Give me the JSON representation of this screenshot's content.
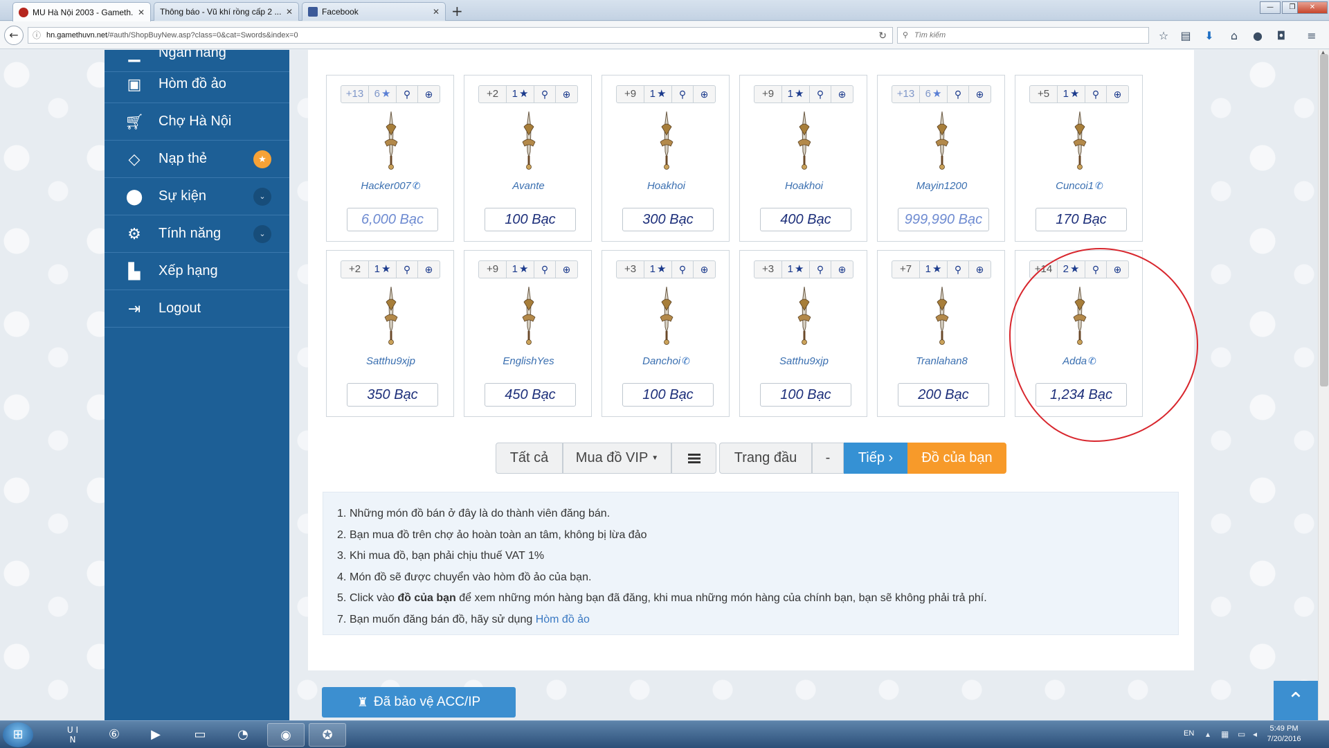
{
  "browser": {
    "tabs": [
      {
        "title": "MU Hà Nội 2003 - Gameth...",
        "favicon_color": "#b5261e"
      },
      {
        "title": "Thông báo - Vũ khí rồng cấp 2 ...",
        "favicon_color": "#8a8f96"
      },
      {
        "title": "Facebook",
        "favicon_color": "#3b5998"
      }
    ],
    "url_host": "hn.gamethuvn.net",
    "url_path": "/#auth/ShopBuyNew.asp?class=0&cat=Swords&index=0",
    "search_placeholder": "Tìm kiếm"
  },
  "sidebar": {
    "items": [
      {
        "label": "Ngân hàng",
        "icon": "bank-icon"
      },
      {
        "label": "Hòm đồ ảo",
        "icon": "suitcase-icon"
      },
      {
        "label": "Chợ Hà Nội",
        "icon": "cart-icon"
      },
      {
        "label": "Nạp thẻ",
        "icon": "diamond-icon",
        "badge": "star"
      },
      {
        "label": "Sự kiện",
        "icon": "android-icon",
        "badge": "chevron"
      },
      {
        "label": "Tính năng",
        "icon": "gears-icon",
        "badge": "chevron"
      },
      {
        "label": "Xếp hạng",
        "icon": "bar-chart-icon"
      },
      {
        "label": "Logout",
        "icon": "sign-out-icon"
      }
    ]
  },
  "items": [
    {
      "plus": "+13",
      "stars": "6",
      "seller": "Hacker007",
      "phone": true,
      "price": "6,000 Bạc",
      "faded": true
    },
    {
      "plus": "+2",
      "stars": "1",
      "seller": "Avante",
      "phone": false,
      "price": "100 Bạc",
      "faded": false
    },
    {
      "plus": "+9",
      "stars": "1",
      "seller": "Hoakhoi",
      "phone": false,
      "price": "300 Bạc",
      "faded": false
    },
    {
      "plus": "+9",
      "stars": "1",
      "seller": "Hoakhoi",
      "phone": false,
      "price": "400 Bạc",
      "faded": false
    },
    {
      "plus": "+13",
      "stars": "6",
      "seller": "Mayin1200",
      "phone": false,
      "price": "999,990 Bạc",
      "faded": true
    },
    {
      "plus": "+5",
      "stars": "1",
      "seller": "Cuncoi1",
      "phone": true,
      "price": "170 Bạc",
      "faded": false
    },
    {
      "plus": "+2",
      "stars": "1",
      "seller": "Satthu9xjp",
      "phone": false,
      "price": "350 Bạc",
      "faded": false
    },
    {
      "plus": "+9",
      "stars": "1",
      "seller": "EnglishYes",
      "phone": false,
      "price": "450 Bạc",
      "faded": false
    },
    {
      "plus": "+3",
      "stars": "1",
      "seller": "Danchoi",
      "phone": true,
      "price": "100 Bạc",
      "faded": false
    },
    {
      "plus": "+3",
      "stars": "1",
      "seller": "Satthu9xjp",
      "phone": false,
      "price": "100 Bạc",
      "faded": false
    },
    {
      "plus": "+7",
      "stars": "1",
      "seller": "Tranlahan8",
      "phone": false,
      "price": "200 Bạc",
      "faded": false
    },
    {
      "plus": "+14",
      "stars": "2",
      "seller": "Adda",
      "phone": true,
      "price": "1,234 Bạc",
      "faded": false
    }
  ],
  "pager": {
    "all": "Tất cả",
    "vip": "Mua đồ VIP",
    "first": "Trang đầu",
    "dash": "-",
    "next": "Tiếp ›",
    "mine": "Đồ của bạn"
  },
  "notes": [
    {
      "num": "1.",
      "text": "Những món đồ bán ở đây là do thành viên đăng bán."
    },
    {
      "num": "2.",
      "text": "Bạn mua đồ trên chợ ảo hoàn toàn an tâm, không bị lừa đảo"
    },
    {
      "num": "3.",
      "text": "Khi mua đồ, bạn phải chịu thuế VAT 1%"
    },
    {
      "num": "4.",
      "text": "Món đồ sẽ được chuyển vào hòm đồ ảo của bạn."
    },
    {
      "num": "5.",
      "pre": "Click vào ",
      "bold1": "đồ của bạn",
      "mid": " để xem những món hàng bạn đã đăng, khi mua những món hàng của chính bạn, bạn sẽ không phải trả phí."
    },
    {
      "num": "7.",
      "pre": "Bạn muốn đăng bán đồ, hãy sử dụng ",
      "link": "Hòm đồ ảo"
    }
  ],
  "protect_label": "Đã bảo vệ ACC/IP",
  "taskbar": {
    "lang": "EN",
    "time": "5:49 PM",
    "date": "7/20/2016"
  },
  "colors": {
    "sidebar_bg": "#1d5f96",
    "accent_blue": "#3591d4",
    "accent_orange": "#f79a2a",
    "annotation_red": "#d8262d"
  }
}
